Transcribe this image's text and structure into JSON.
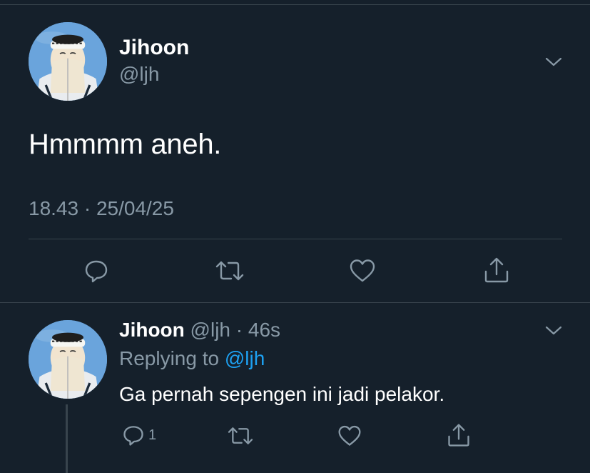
{
  "tweet": {
    "author_name": "Jihoon",
    "author_handle": "@ljh",
    "text": "Hmmmm aneh.",
    "timestamp": "18.43 · 25/04/25",
    "actions": {
      "reply_icon": "reply-icon",
      "retweet_icon": "retweet-icon",
      "like_icon": "heart-icon",
      "share_icon": "share-icon"
    }
  },
  "reply": {
    "author_name": "Jihoon",
    "meta": "@ljh · 46s",
    "replying_prefix": "Replying to",
    "replying_to": "@ljh",
    "text": "Ga pernah sepengen ini jadi pelakor.",
    "reply_count": "1"
  },
  "colors": {
    "background": "#15202b",
    "secondary_text": "#8899a6",
    "link": "#1da1f2",
    "divider": "#38444d"
  }
}
